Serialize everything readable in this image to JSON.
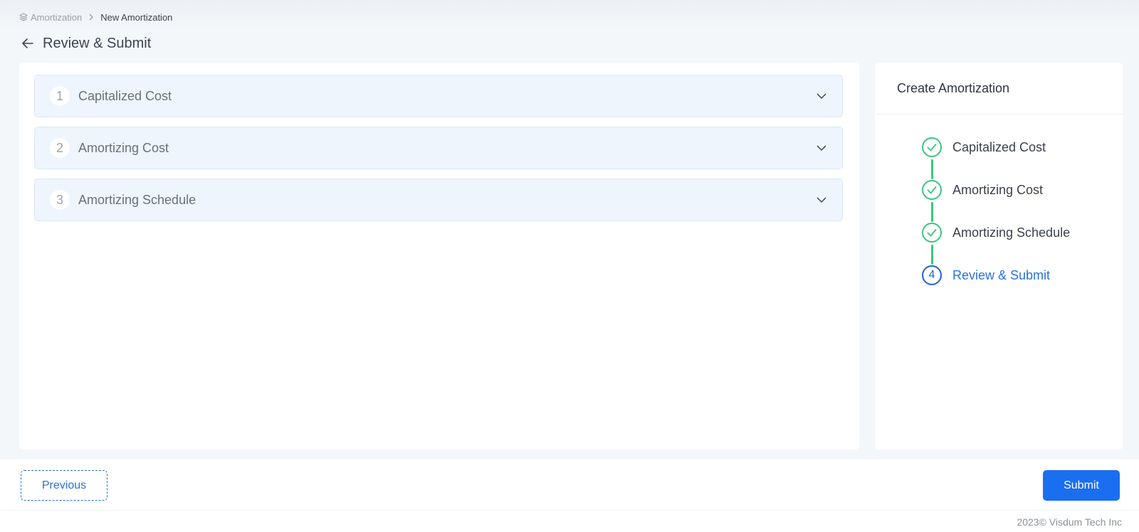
{
  "breadcrumb": {
    "icon": "layers-icon",
    "root": "Amortization",
    "current": "New Amortization"
  },
  "page": {
    "title": "Review & Submit",
    "back_icon": "arrow-left-icon"
  },
  "accordion": {
    "items": [
      {
        "number": "1",
        "label": "Capitalized Cost"
      },
      {
        "number": "2",
        "label": "Amortizing Cost"
      },
      {
        "number": "3",
        "label": "Amortizing Schedule"
      }
    ]
  },
  "stepper": {
    "title": "Create Amortization",
    "steps": [
      {
        "label": "Capitalized Cost",
        "state": "done",
        "icon": "check-icon"
      },
      {
        "label": "Amortizing Cost",
        "state": "done",
        "icon": "check-icon"
      },
      {
        "label": "Amortizing Schedule",
        "state": "done",
        "icon": "check-icon"
      },
      {
        "label": "Review & Submit",
        "state": "active",
        "number": "4"
      }
    ]
  },
  "footer": {
    "previous_label": "Previous",
    "submit_label": "Submit",
    "copyright": "2023© Visdum Tech Inc"
  },
  "colors": {
    "primary": "#1a6ff0",
    "success": "#3cc57e",
    "accordion_bg": "#eef5fd",
    "page_bg": "#f4f7fa"
  }
}
